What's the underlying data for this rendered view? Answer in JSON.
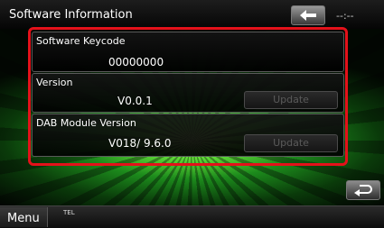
{
  "header": {
    "title": "Software Information",
    "clock": "--:--"
  },
  "sections": [
    {
      "label": "Software Keycode",
      "value": "00000000"
    },
    {
      "label": "Version",
      "value": "V0.0.1",
      "button": "Update"
    },
    {
      "label": "DAB Module Version",
      "value": "V018/ 9.6.0",
      "button": "Update"
    }
  ],
  "footer": {
    "menu_label": "Menu",
    "tel_label": "TEL"
  },
  "colors": {
    "highlight_frame": "#e4111a",
    "background_glow": "#64e03a"
  },
  "icons": [
    "back-arrow-icon",
    "return-icon"
  ]
}
